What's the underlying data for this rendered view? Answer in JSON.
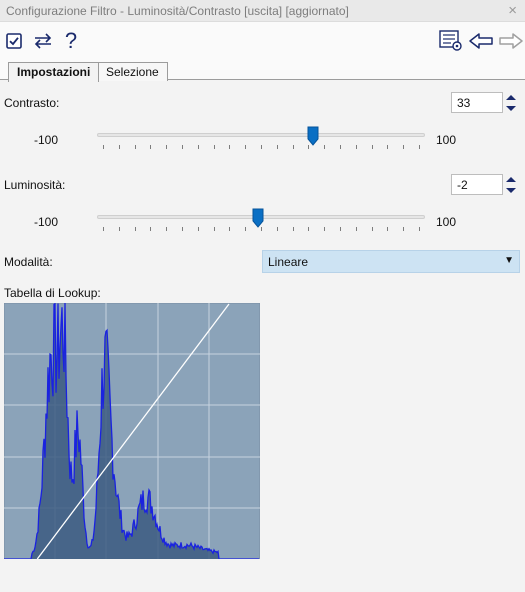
{
  "window": {
    "title": "Configurazione Filtro - Luminosità/Contrasto [uscita] [aggiornato]",
    "close_glyph": "×"
  },
  "toolbar": {
    "icons": [
      "checkbox-checked-icon",
      "swap-arrows-icon",
      "help-icon",
      "settings-list-icon",
      "arrow-left-icon",
      "arrow-right-icon"
    ],
    "help_glyph": "?"
  },
  "tabs": [
    {
      "label": "Impostazioni",
      "active": true
    },
    {
      "label": "Selezione",
      "active": false
    }
  ],
  "contrasto": {
    "label": "Contrasto:",
    "value": "33",
    "min_label": "-100",
    "max_label": "100",
    "min": -100,
    "max": 100,
    "current": 33
  },
  "luminosita": {
    "label": "Luminosità:",
    "value": "-2",
    "min_label": "-100",
    "max_label": "100",
    "min": -100,
    "max": 100,
    "current": -2
  },
  "modalita": {
    "label": "Modalità:",
    "selected": "Lineare"
  },
  "lookup": {
    "label": "Tabella di Lookup:"
  },
  "colors": {
    "accent": "#0a6fc4",
    "histogram_bg": "#8ba3b9",
    "histogram_fill": "#3b5a80",
    "histogram_line": "#1a22e0",
    "dropdown_bg": "#cde3f3"
  }
}
